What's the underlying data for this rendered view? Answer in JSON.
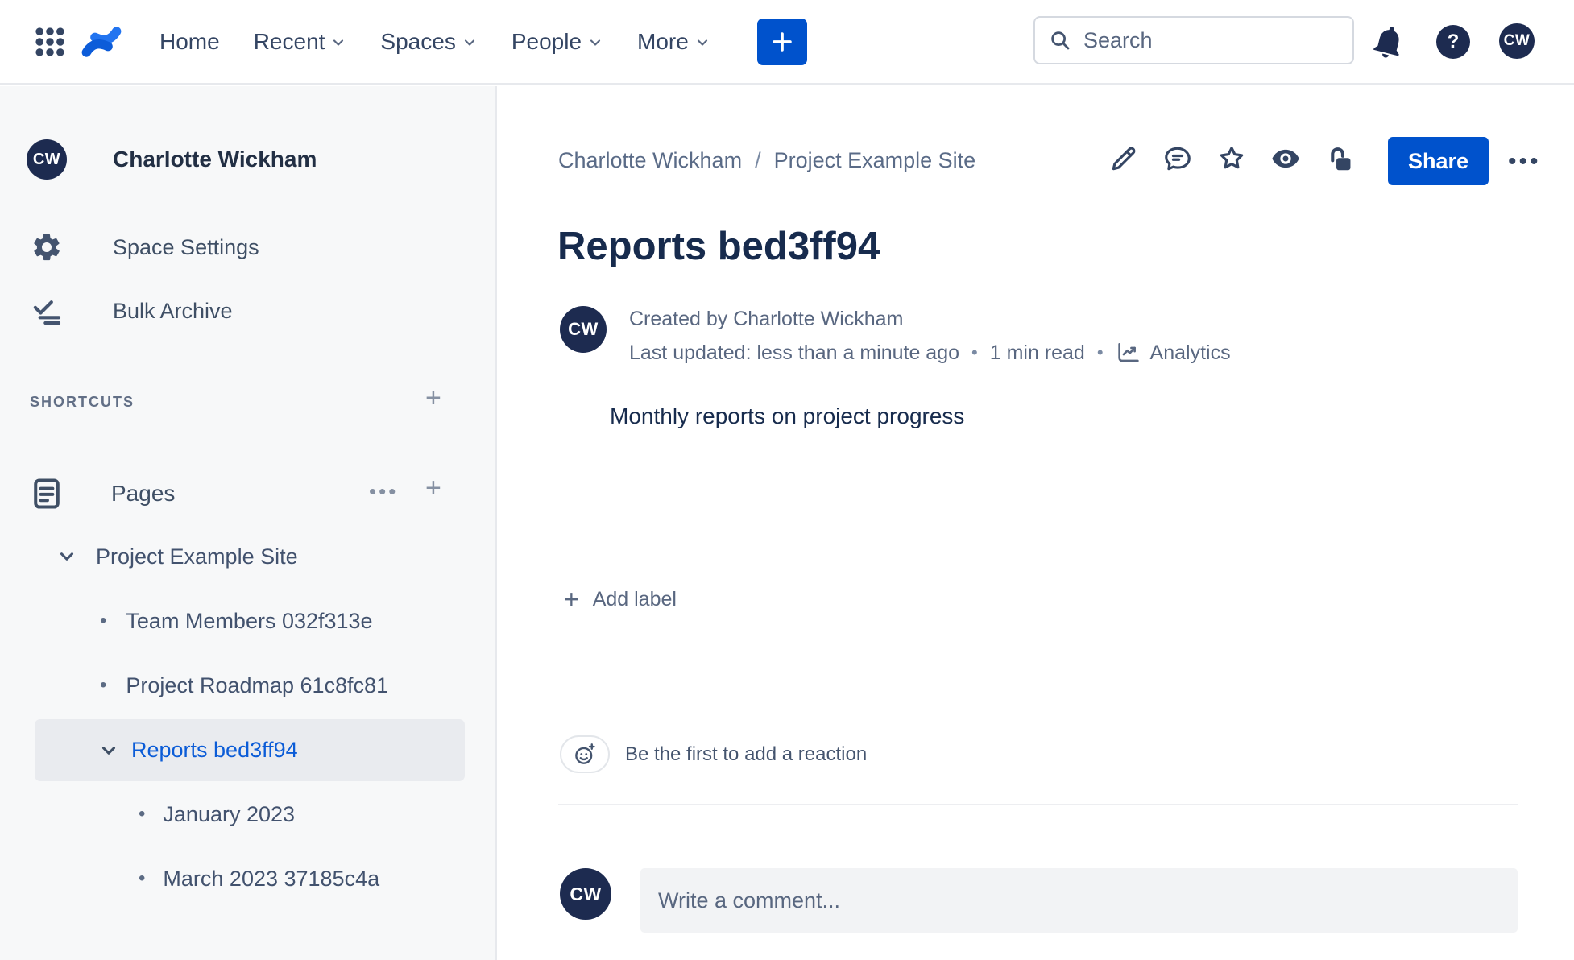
{
  "topbar": {
    "nav": [
      {
        "label": "Home",
        "chevron": false
      },
      {
        "label": "Recent",
        "chevron": true
      },
      {
        "label": "Spaces",
        "chevron": true
      },
      {
        "label": "People",
        "chevron": true
      },
      {
        "label": "More",
        "chevron": true
      }
    ],
    "search": {
      "placeholder": "Search"
    },
    "avatar_initials": "CW"
  },
  "sidebar": {
    "space_avatar_initials": "CW",
    "space_name": "Charlotte Wickham",
    "menu": {
      "settings": "Space Settings",
      "archive": "Bulk Archive"
    },
    "shortcuts_header": "SHORTCUTS",
    "pages_label": "Pages",
    "pages_more": "•••",
    "plus": "+",
    "tree": {
      "items": [
        {
          "label": "Project Example Site",
          "level": 0,
          "marker": "chevron",
          "selected": false
        },
        {
          "label": "Team Members 032f313e",
          "level": 1,
          "marker": "bullet",
          "selected": false
        },
        {
          "label": "Project Roadmap 61c8fc81",
          "level": 1,
          "marker": "bullet",
          "selected": false
        },
        {
          "label": "Reports bed3ff94",
          "level": 1,
          "marker": "chevron",
          "selected": true
        },
        {
          "label": "January 2023",
          "level": 2,
          "marker": "bullet",
          "selected": false
        },
        {
          "label": "March 2023 37185c4a",
          "level": 2,
          "marker": "bullet",
          "selected": false
        }
      ],
      "bullet_glyph": "•"
    }
  },
  "content": {
    "breadcrumb": {
      "items": [
        "Charlotte Wickham",
        "Project Example Site"
      ],
      "separator": "/"
    },
    "share_label": "Share",
    "more_dots": "•••",
    "page": {
      "title": "Reports bed3ff94",
      "byline_created": "Created by Charlotte Wickham",
      "byline_updated": "Last updated: less than a minute ago",
      "byline_separator": "•",
      "byline_read_time": "1 min read",
      "byline_analytics": "Analytics",
      "avatar_initials": "CW",
      "body_text": "Monthly reports on project progress",
      "add_label_plus": "+",
      "add_label_text": "Add label"
    },
    "reactions": {
      "prompt": "Be the first to add a reaction"
    },
    "comment": {
      "placeholder": "Write a comment...",
      "avatar_initials": "CW"
    }
  },
  "colors": {
    "brand_blue": "#0052cc",
    "selected_link_blue": "#0b5cd7",
    "text_navy": "#172b4d",
    "text_muted": "#596780",
    "sidebar_bg": "#f7f8f9",
    "selected_row_bg": "#e9ebef",
    "border": "#e7e9ed",
    "avatar_bg": "#1d2b50"
  }
}
